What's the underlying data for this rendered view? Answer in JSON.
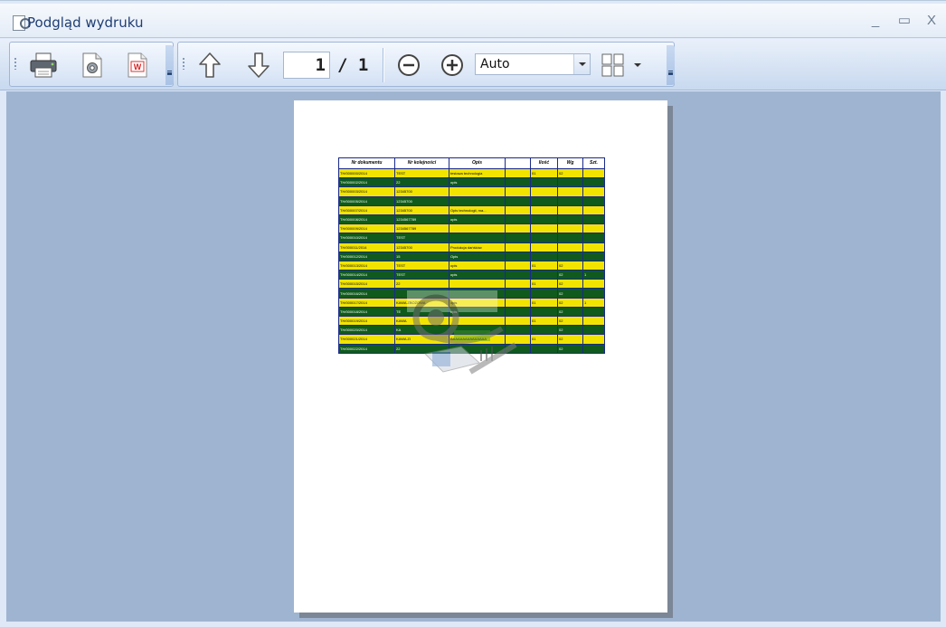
{
  "window": {
    "title": "Podgląd wydruku",
    "minimize": "_",
    "maximize": "▭",
    "close": "X"
  },
  "toolbar": {
    "print_icon": "printer-icon",
    "settings_icon": "page-settings-icon",
    "export_icon": "export-document-icon",
    "prev_icon": "arrow-up-icon",
    "next_icon": "arrow-down-icon",
    "current_page": "1",
    "page_total": "/ 1",
    "zoom_out_icon": "zoom-out-icon",
    "zoom_in_icon": "zoom-in-icon",
    "zoom_value": "Auto",
    "multi_page_icon": "multi-page-icon"
  },
  "report": {
    "headers": [
      "Nr dokumentu",
      "Nr kolejności",
      "Opis",
      "",
      "Ilość",
      "Wg",
      "Szt."
    ],
    "rows": [
      {
        "c": [
          "TH/000000/2014",
          "TEST",
          "testowa technologia",
          "",
          "01",
          "02",
          ""
        ]
      },
      {
        "c": [
          "TH/000002/2014",
          "22",
          "opis",
          "",
          "",
          "",
          ""
        ]
      },
      {
        "c": [
          "TH/000003/2014",
          "12345700",
          "",
          "",
          "",
          "",
          ""
        ]
      },
      {
        "c": [
          "TH/000005/2014",
          "12345700",
          "",
          "",
          "",
          "",
          ""
        ]
      },
      {
        "c": [
          "TH/000007/2014",
          "12345700",
          "Opis technologii, ma...",
          "",
          "",
          "",
          ""
        ]
      },
      {
        "c": [
          "TH/000008/2014",
          "1234567789",
          "opis",
          "",
          "",
          "",
          ""
        ]
      },
      {
        "c": [
          "TH/000009/2014",
          "1234567789",
          "",
          "",
          "",
          "",
          ""
        ]
      },
      {
        "c": [
          "TH/000010/2014",
          "TEST",
          "",
          "",
          "",
          "",
          ""
        ]
      },
      {
        "c": [
          "TH/000011/2014",
          "12345700",
          "Produkcja dańśków",
          "",
          "",
          "",
          ""
        ]
      },
      {
        "c": [
          "TH/000012/2014",
          "15",
          "Opis",
          "",
          "",
          "",
          ""
        ]
      },
      {
        "c": [
          "TH/000013/2014",
          "TEST",
          "opis",
          "",
          "01",
          "02",
          ""
        ]
      },
      {
        "c": [
          "TH/000014/2014",
          "TEST",
          "opis",
          "",
          "",
          "02",
          "1"
        ]
      },
      {
        "c": [
          "TH/000015/2014",
          "22",
          "",
          "",
          "01",
          "02",
          ""
        ]
      },
      {
        "c": [
          "TH/000016/2014",
          "",
          "",
          "",
          "",
          "02",
          ""
        ]
      },
      {
        "c": [
          "TH/000017/2014",
          "KAWA ZBOŻOWA",
          "opis",
          "",
          "01",
          "02",
          "1"
        ]
      },
      {
        "c": [
          "TH/000018/2014",
          "TE",
          "opis",
          "",
          "",
          "02",
          ""
        ]
      },
      {
        "c": [
          "TH/000019/2014",
          "KAWA",
          "",
          "",
          "01",
          "02",
          ""
        ]
      },
      {
        "c": [
          "TH/000020/2014",
          "KA",
          "",
          "",
          "",
          "02",
          ""
        ]
      },
      {
        "c": [
          "TH/000021/2014",
          "KAWA ZI",
          "AAAAAAAAAAAAAAA",
          "",
          "01",
          "02",
          ""
        ]
      },
      {
        "c": [
          "TH/000022/2014",
          "22",
          "",
          "",
          "",
          "02",
          ""
        ]
      }
    ]
  },
  "colors": {
    "row_yellow": "#f2e400",
    "row_green": "#0f5a1c",
    "preview_bg": "#9fb4d0"
  }
}
